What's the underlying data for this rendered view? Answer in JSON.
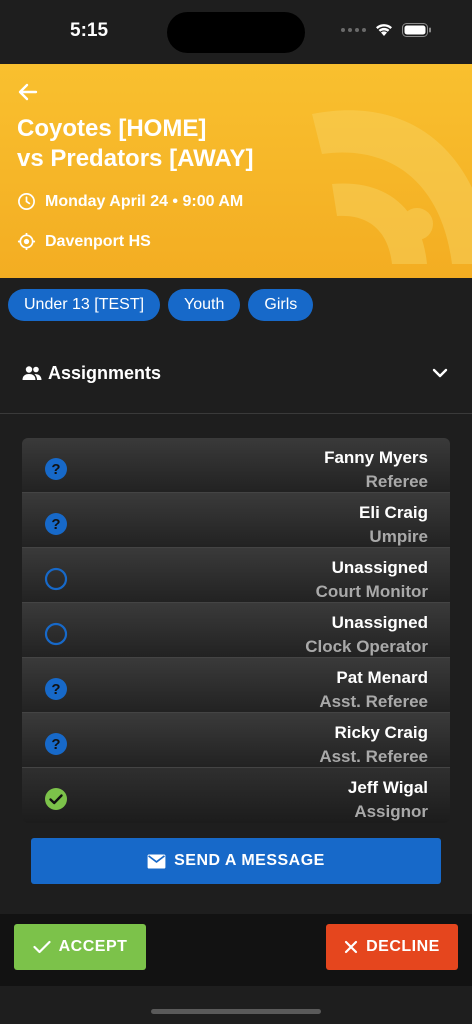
{
  "status_bar": {
    "time": "5:15"
  },
  "game": {
    "title_line1": "Coyotes [HOME]",
    "title_line2": "vs Predators [AWAY]",
    "datetime": "Monday April 24 • 9:00 AM",
    "location": "Davenport HS"
  },
  "tags": [
    "Under 13 [TEST]",
    "Youth",
    "Girls"
  ],
  "assignments": {
    "label": "Assignments",
    "rows": [
      {
        "name": "Fanny Myers",
        "role": "Referee",
        "status": "pending"
      },
      {
        "name": "Eli Craig",
        "role": "Umpire",
        "status": "pending"
      },
      {
        "name": "Unassigned",
        "role": "Court Monitor",
        "status": "open"
      },
      {
        "name": "Unassigned",
        "role": "Clock Operator",
        "status": "open"
      },
      {
        "name": "Pat Menard",
        "role": "Asst. Referee",
        "status": "pending"
      },
      {
        "name": "Ricky Craig",
        "role": "Asst. Referee",
        "status": "pending"
      },
      {
        "name": "Jeff Wigal",
        "role": "Assignor",
        "status": "accepted"
      }
    ]
  },
  "actions": {
    "message_label": "SEND A MESSAGE",
    "accept_label": "ACCEPT",
    "decline_label": "DECLINE"
  },
  "colors": {
    "hero": "#f9c02f",
    "chip": "#1769c9",
    "pending_icon": "#1769c9",
    "accepted_icon": "#7cc24a",
    "accept": "#7cc24a",
    "decline": "#e5461e"
  },
  "icons": {
    "pending": "question-circle-icon",
    "open": "empty-circle-icon",
    "accepted": "check-circle-icon"
  }
}
